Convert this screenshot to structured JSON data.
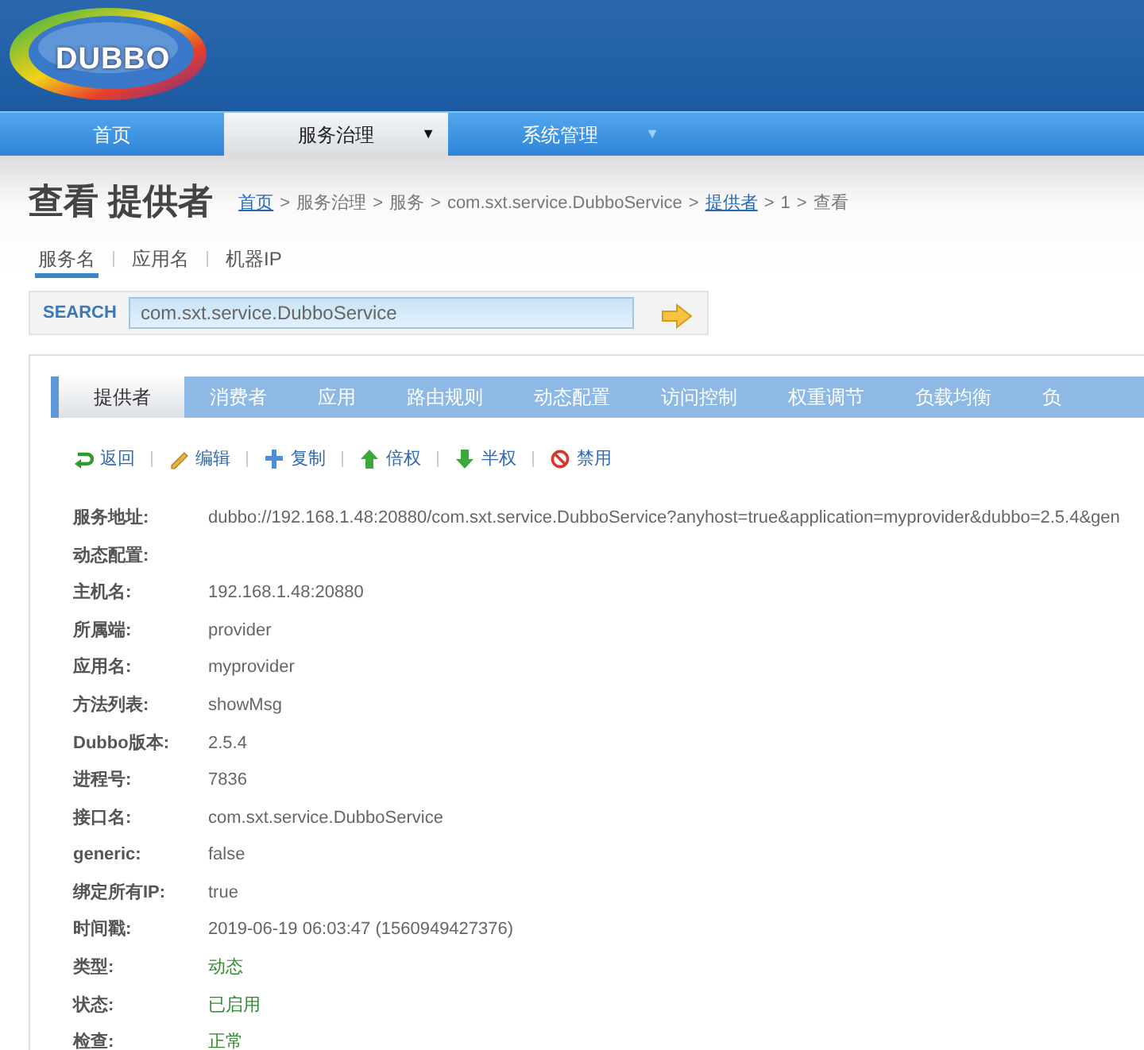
{
  "logo": {
    "text": "DUBBO"
  },
  "nav": [
    {
      "label": "首页",
      "selected": false
    },
    {
      "label": "服务治理",
      "selected": true,
      "caret": "▼"
    },
    {
      "label": "系统管理",
      "selected": false,
      "caret": "▼"
    }
  ],
  "page_title": "查看 提供者",
  "breadcrumb": {
    "separator": ">",
    "items": [
      {
        "text": "首页",
        "link": true
      },
      {
        "text": "服务治理",
        "link": false
      },
      {
        "text": "服务",
        "link": false
      },
      {
        "text": "com.sxt.service.DubboService",
        "link": false
      },
      {
        "text": "提供者",
        "link": true
      },
      {
        "text": "1",
        "link": false
      },
      {
        "text": "查看",
        "link": false
      }
    ]
  },
  "search_tabs": [
    {
      "label": "服务名",
      "selected": true
    },
    {
      "label": "应用名",
      "selected": false
    },
    {
      "label": "机器IP",
      "selected": false
    }
  ],
  "search": {
    "label": "SEARCH",
    "value": "com.sxt.service.DubboService"
  },
  "tabs": [
    {
      "label": "提供者",
      "selected": true
    },
    {
      "label": "消费者",
      "selected": false
    },
    {
      "label": "应用",
      "selected": false
    },
    {
      "label": "路由规则",
      "selected": false
    },
    {
      "label": "动态配置",
      "selected": false
    },
    {
      "label": "访问控制",
      "selected": false
    },
    {
      "label": "权重调节",
      "selected": false
    },
    {
      "label": "负载均衡",
      "selected": false
    },
    {
      "label": "负",
      "selected": false
    }
  ],
  "actions": [
    {
      "kind": "back",
      "label": "返回"
    },
    {
      "kind": "edit",
      "label": "编辑"
    },
    {
      "kind": "copy",
      "label": "复制"
    },
    {
      "kind": "up",
      "label": "倍权"
    },
    {
      "kind": "down",
      "label": "半权"
    },
    {
      "kind": "disable",
      "label": "禁用"
    }
  ],
  "details": [
    {
      "label": "服务地址:",
      "value": "dubbo://192.168.1.48:20880/com.sxt.service.DubboService?anyhost=true&application=myprovider&dubbo=2.5.4&gen",
      "kind": "text"
    },
    {
      "label": "动态配置:"
    },
    {
      "label": "主机名:",
      "value": "192.168.1.48:20880",
      "kind": "text"
    },
    {
      "label": "所属端:",
      "value": "provider",
      "kind": "text"
    },
    {
      "label": "应用名:",
      "value": "myprovider",
      "kind": "text"
    },
    {
      "label": "方法列表:",
      "value": "showMsg",
      "kind": "text"
    },
    {
      "label": "Dubbo版本:",
      "value": "2.5.4",
      "kind": "text"
    },
    {
      "label": "进程号:",
      "value": "7836",
      "kind": "text"
    },
    {
      "label": "接口名:",
      "value": "com.sxt.service.DubboService",
      "kind": "text"
    },
    {
      "label": "generic:",
      "value": "false",
      "kind": "text"
    },
    {
      "label": "绑定所有IP:",
      "value": "true",
      "kind": "text"
    },
    {
      "label": "时间戳:",
      "value": "2019-06-19 06:03:47 (1560949427376)",
      "kind": "text"
    },
    {
      "label": "类型:",
      "value": "动态",
      "kind": "status"
    },
    {
      "label": "状态:",
      "value": "已启用",
      "kind": "status"
    },
    {
      "label": "检查:",
      "value": "正常",
      "kind": "status"
    }
  ]
}
